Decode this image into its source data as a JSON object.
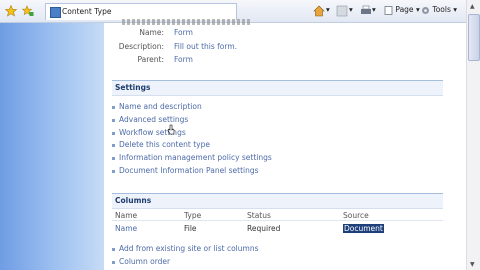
{
  "browser": {
    "tab_title": "Content Type",
    "page_menu": "Page",
    "tools_menu": "Tools"
  },
  "properties": [
    {
      "label": "Name:",
      "value": "Form"
    },
    {
      "label": "Description:",
      "value": "Fill out this form."
    },
    {
      "label": "Parent:",
      "value": "Form"
    }
  ],
  "settings": {
    "title": "Settings",
    "items": [
      "Name and description",
      "Advanced settings",
      "Workflow settings",
      "Delete this content type",
      "Information management policy settings",
      "Document Information Panel settings"
    ]
  },
  "columns": {
    "title": "Columns",
    "headers": [
      "Name",
      "Type",
      "Status",
      "Source"
    ],
    "rows": [
      {
        "name": "Name",
        "type": "File",
        "status": "Required",
        "source": "Document"
      }
    ],
    "links": [
      "Add from existing site or list columns",
      "Column order"
    ]
  }
}
